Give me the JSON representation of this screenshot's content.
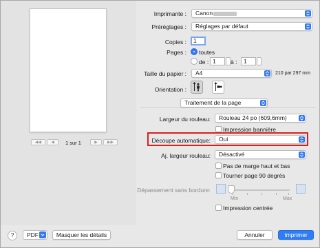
{
  "printer": {
    "label": "Imprimante :",
    "value": "Canon"
  },
  "presets": {
    "label": "Préréglages :",
    "value": "Réglages par défaut"
  },
  "copies": {
    "label": "Copies :",
    "value": "1"
  },
  "pages": {
    "label": "Pages :",
    "all_label": "toutes",
    "from_label": "de :",
    "from_value": "1",
    "to_label": "à :",
    "to_value": "1",
    "selected": "all"
  },
  "paper_size": {
    "label": "Taille du papier :",
    "value": "A4",
    "dimensions": "210 par 297 mm"
  },
  "orientation": {
    "label": "Orientation :",
    "selected": "portrait"
  },
  "section": {
    "value": "Traitement de la page"
  },
  "roll_width": {
    "label": "Largeur du rouleau:",
    "value": "Rouleau 24 po (609,6mm)"
  },
  "banner": {
    "label": "Impression bannière",
    "checked": false
  },
  "auto_cut": {
    "label": "Découpe automatique:",
    "value": "Oui"
  },
  "fit_roll": {
    "label": "Aj. largeur rouleau:",
    "value": "Désactivé"
  },
  "no_margin": {
    "label": "Pas de marge haut et bas",
    "checked": false
  },
  "rotate": {
    "label": "Tourner page 90 degrés",
    "checked": false
  },
  "overflow": {
    "label": "Dépassement sans bordure:",
    "min_label": "Min",
    "max_label": "Max",
    "level": 0
  },
  "center": {
    "label": "Impression centrée",
    "checked": false
  },
  "preview_nav": {
    "page_indicator": "1 sur 1"
  },
  "footer": {
    "help": "?",
    "pdf": "PDF",
    "hide_details": "Masquer les détails",
    "cancel": "Annuler",
    "print": "Imprimer"
  },
  "colors": {
    "accent": "#3478f6",
    "highlight": "#d9201c"
  }
}
